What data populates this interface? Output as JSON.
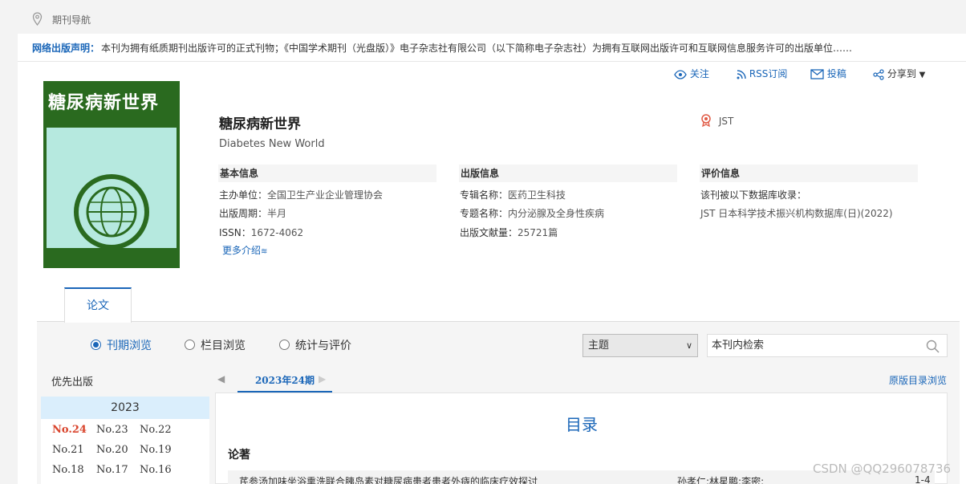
{
  "breadcrumb": {
    "label": "期刊导航"
  },
  "notice": {
    "label": "网络出版声明：",
    "text": "本刊为拥有纸质期刊出版许可的正式刊物；《中国学术期刊（光盘版）》电子杂志社有限公司（以下简称电子杂志社）为拥有互联网出版许可和互联网信息服务许可的出版单位……"
  },
  "actions": {
    "follow": "关注",
    "rss": "RSS订阅",
    "submit": "投稿",
    "share": "分享到"
  },
  "cover": {
    "title": "糖尿病新世界"
  },
  "journal": {
    "title": "糖尿病新世界",
    "title_en": "Diabetes New World",
    "badge": "JST"
  },
  "basic": {
    "heading": "基本信息",
    "sponsor_label": "主办单位：",
    "sponsor": "全国卫生产业企业管理协会",
    "period_label": "出版周期：",
    "period": "半月",
    "issn_label": "ISSN：",
    "issn": "1672-4062",
    "more": "更多介绍"
  },
  "publish": {
    "heading": "出版信息",
    "series_label": "专辑名称：",
    "series": "医药卫生科技",
    "topic_label": "专题名称：",
    "topic": "内分泌腺及全身性疾病",
    "count_label": "出版文献量：",
    "count": "25721篇"
  },
  "eval": {
    "heading": "评价信息",
    "line1": "该刊被以下数据库收录：",
    "line2": "JST 日本科学技术振兴机构数据库(日)(2022)"
  },
  "tabs": {
    "papers": "论文"
  },
  "browse": {
    "issue": "刊期浏览",
    "column": "栏目浏览",
    "stats": "统计与评价"
  },
  "search": {
    "field": "主题",
    "placeholder": "本刊内检索"
  },
  "priority": "优先出版",
  "year": "2023",
  "issues": [
    "No.24",
    "No.23",
    "No.22",
    "No.21",
    "No.20",
    "No.19",
    "No.18",
    "No.17",
    "No.16"
  ],
  "current_period": "2023年24期",
  "orig_link": "原版目录浏览",
  "toc": {
    "title": "目录",
    "section": "论著",
    "article": {
      "title": "芪参汤加味坐浴熏洗联合胰岛素对糖尿病患者患者外痔的临床疗效探讨",
      "authors": "孙孝仁;林星鹏;李密;",
      "pages": "1-4"
    }
  },
  "watermark": "CSDN @QQ296078736"
}
